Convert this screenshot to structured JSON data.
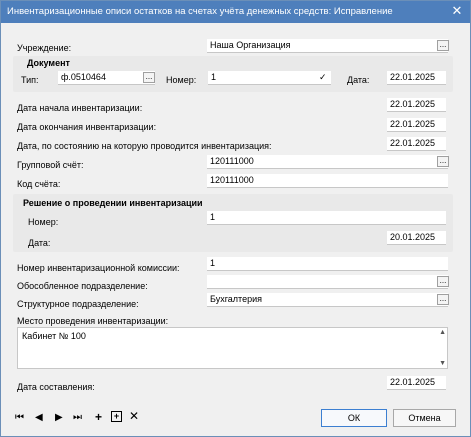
{
  "window": {
    "title": "Инвентаризационные описи остатков на счетах учёта денежных средств: Исправление",
    "close_glyph": "✕"
  },
  "institution": {
    "label": "Учреждение:",
    "value": "Наша Организация"
  },
  "document": {
    "title": "Документ",
    "type_label": "Тип:",
    "type_value": "ф.0510464",
    "number_label": "Номер:",
    "number_value": "1",
    "date_label": "Дата:",
    "date_value": "22.01.2025"
  },
  "dates": {
    "start_label": "Дата начала инвентаризации:",
    "start_value": "22.01.2025",
    "end_label": "Дата окончания инвентаризации:",
    "end_value": "22.01.2025",
    "asof_label": "Дата, по состоянию на которую проводится инвентаризация:",
    "asof_value": "22.01.2025"
  },
  "account": {
    "group_label": "Групповой счёт:",
    "group_value": "120111000",
    "code_label": "Код счёта:",
    "code_value": "120111000"
  },
  "decision": {
    "title": "Решение о проведении инвентаризации",
    "number_label": "Номер:",
    "number_value": "1",
    "date_label": "Дата:",
    "date_value": "20.01.2025"
  },
  "commission": {
    "label": "Номер инвентаризационной комиссии:",
    "value": "1"
  },
  "separate_division": {
    "label": "Обособленное подразделение:",
    "value": ""
  },
  "structural_division": {
    "label": "Структурное подразделение:",
    "value": "Бухгалтерия"
  },
  "place": {
    "label": "Место проведения инвентаризации:",
    "value": "Кабинет № 100"
  },
  "compiled": {
    "label": "Дата составления:",
    "value": "22.01.2025"
  },
  "buttons": {
    "ok": "ОК",
    "cancel": "Отмена",
    "ellipsis": "..."
  },
  "nav_icons": [
    "first-record-icon",
    "prev-record-icon",
    "next-record-icon",
    "last-record-icon",
    "add-record-icon",
    "copy-record-icon",
    "delete-record-icon"
  ],
  "colors": {
    "titlebar": "#4e7fbc",
    "window_bg": "#f0f0f0",
    "ok_border": "#3c7fd1"
  }
}
